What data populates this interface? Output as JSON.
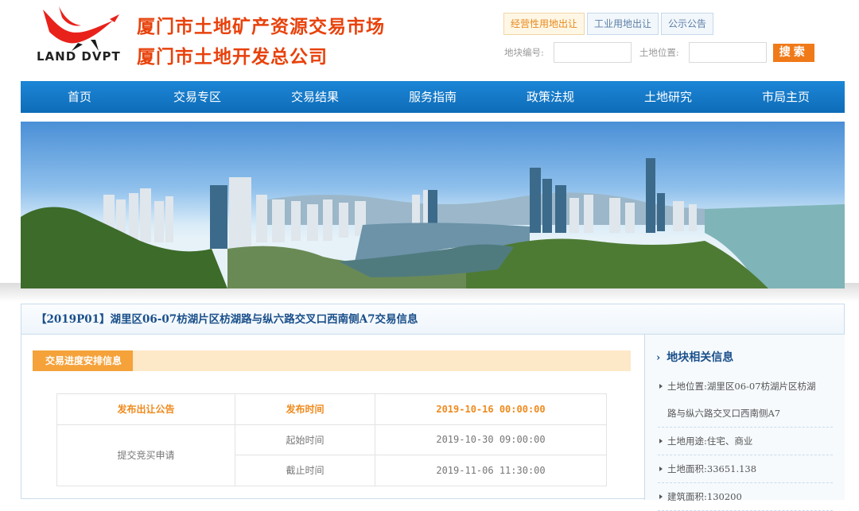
{
  "header": {
    "logo_text": "LAND DVPT",
    "title_line1": "厦门市土地矿产资源交易市场",
    "title_line2": "厦门市土地开发总公司",
    "tabs": [
      {
        "label": "经营性用地出让",
        "active": true
      },
      {
        "label": "工业用地出让",
        "active": false
      },
      {
        "label": "公示公告",
        "active": false
      }
    ],
    "search": {
      "plot_label": "地块编号:",
      "location_label": "土地位置:",
      "button": "搜索"
    }
  },
  "nav": [
    "首页",
    "交易专区",
    "交易结果",
    "服务指南",
    "政策法规",
    "土地研究",
    "市局主页"
  ],
  "info": {
    "title": "【2019P01】湖里区06-07枋湖片区枋湖路与纵六路交叉口西南侧A7交易信息",
    "progress_tag": "交易进度安排信息",
    "table": {
      "row1": {
        "col1": "发布出让公告",
        "col2": "发布时间",
        "col3": "2019-10-16 00:00:00"
      },
      "row2": {
        "col1": "提交竞买申请",
        "start_label": "起始时间",
        "start_value": "2019-10-30 09:00:00",
        "end_label": "截止时间",
        "end_value": "2019-11-06 11:30:00"
      }
    },
    "related": {
      "title": "地块相关信息",
      "items": [
        "土地位置:湖里区06-07枋湖片区枋湖",
        "路与纵六路交叉口西南侧A7",
        "土地用途:住宅、商业",
        "土地面积:33651.138",
        "建筑面积:130200"
      ]
    }
  },
  "colors": {
    "title_red": "#e8420c",
    "nav_blue": "#0e6cb8",
    "accent_orange": "#f07a18"
  }
}
